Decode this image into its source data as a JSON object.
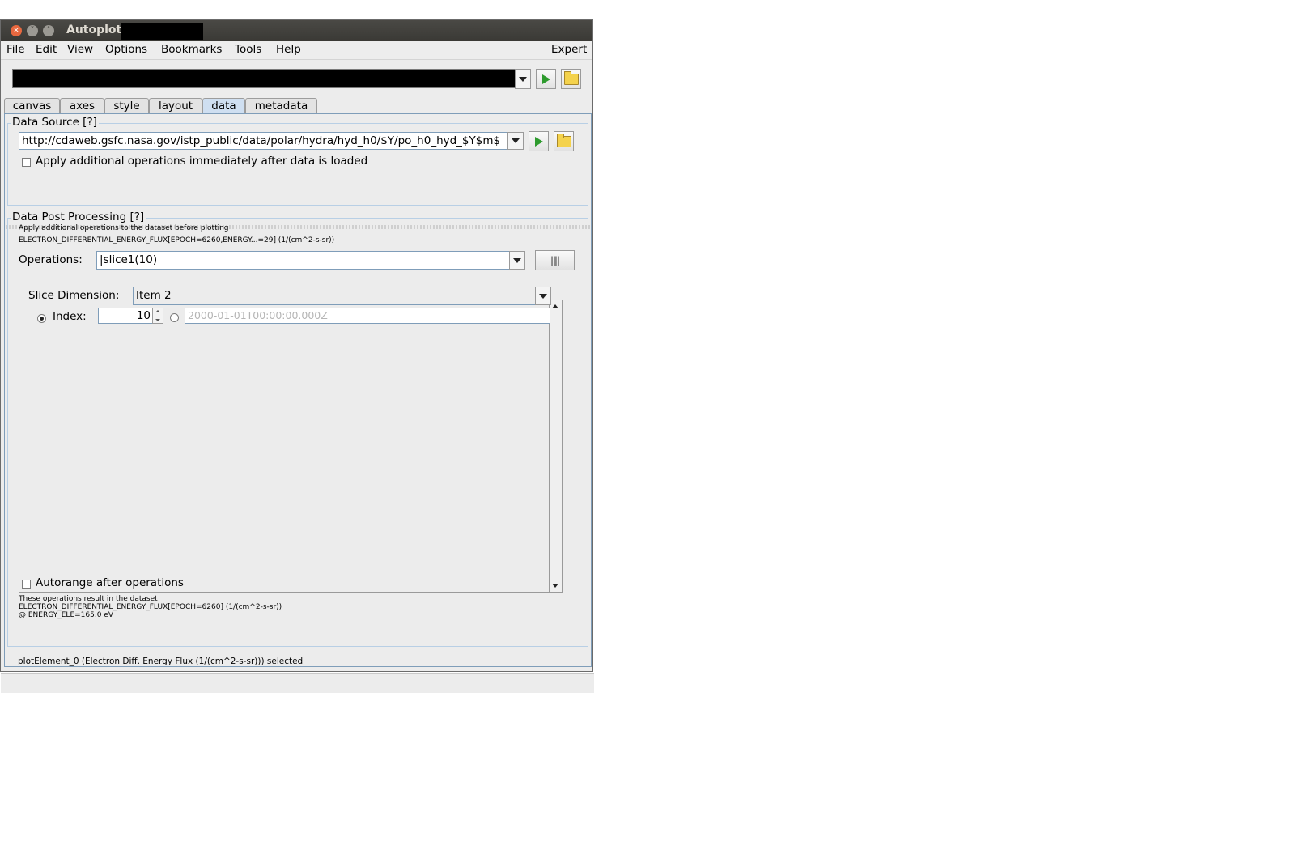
{
  "window": {
    "title": "Autoplot"
  },
  "menu": {
    "items": [
      "File",
      "Edit",
      "View",
      "Options",
      "Bookmarks",
      "Tools",
      "Help"
    ],
    "right": "Expert"
  },
  "tabs": [
    "canvas",
    "axes",
    "style",
    "layout",
    "data",
    "metadata"
  ],
  "selected_tab": "data",
  "data_source": {
    "title": "Data Source [?]",
    "url": "http://cdaweb.gsfc.nasa.gov/istp_public/data/polar/hydra/hyd_h0/$Y/po_h0_hyd_$Y$m$",
    "apply_checkbox_label": "Apply additional operations immediately after data is loaded"
  },
  "post_processing": {
    "title": "Data Post Processing [?]",
    "hint": "Apply additional operations to the dataset before plotting",
    "input_dataset": "ELECTRON_DIFFERENTIAL_ENERGY_FLUX[EPOCH=6260,ENERGY...=29] (1/(cm^2-s-sr))",
    "operations_label": "Operations:",
    "operations_value": "|slice1(10)",
    "slice_dimension_label": "Slice Dimension:",
    "slice_dimension_value": "Item 2",
    "index_label": "Index:",
    "index_value": "10",
    "time_placeholder": "2000-01-01T00:00:00.000Z",
    "autorange_label": "Autorange after operations",
    "result_line1": "These operations result in the dataset",
    "result_line2": "ELECTRON_DIFFERENTIAL_ENERGY_FLUX[EPOCH=6260] (1/(cm^2-s-sr))",
    "result_line3": "@ ENERGY_ELE=165.0 eV"
  },
  "status": "plotElement_0 (Electron Diff. Energy Flux (1/(cm^2-s-sr))) selected",
  "colors": {
    "accent_tab": "#cfdff1",
    "play_green": "#2e9b2e",
    "title_bar": "#3c3b37",
    "close_btn": "#e8683f"
  },
  "icons": [
    "close-icon",
    "minimize-icon",
    "maximize-icon",
    "play-icon",
    "folder-icon",
    "chevron-down-icon",
    "filter-editor-icon"
  ]
}
